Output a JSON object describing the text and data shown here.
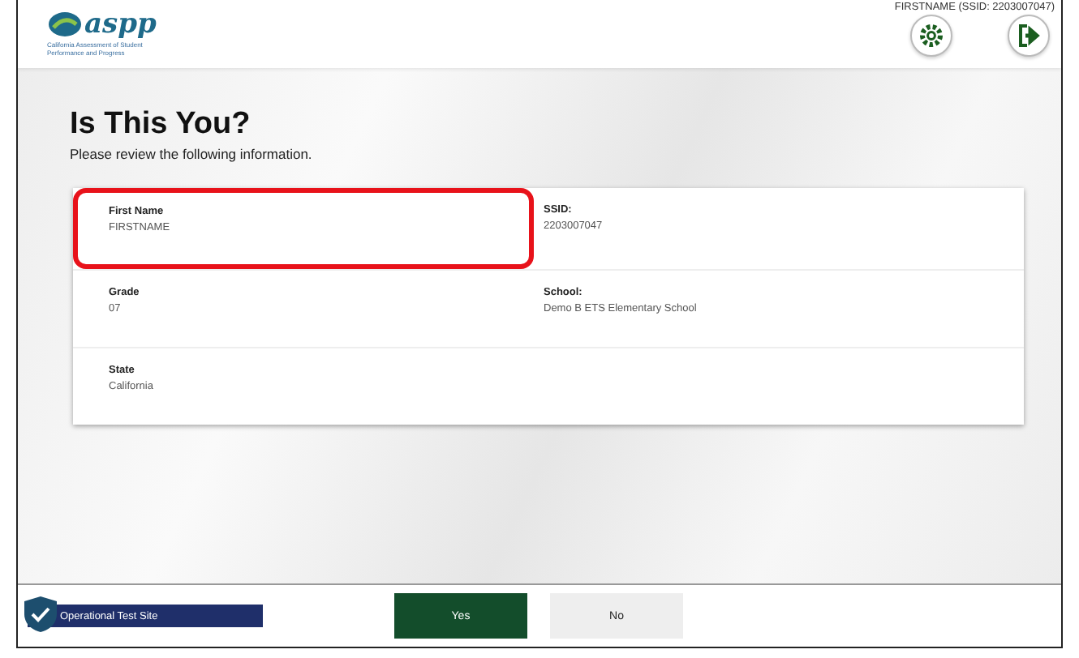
{
  "header": {
    "logo": "aspp",
    "logo_subtitle": "California Assessment of Student Performance and Progress",
    "user": "FIRSTNAME (SSID: 2203007047)"
  },
  "page": {
    "title": "Is This You?",
    "subtitle": "Please review the following information."
  },
  "fields": [
    {
      "label": "First Name",
      "value": "FIRSTNAME",
      "highlighted": true
    },
    {
      "label": "SSID:",
      "value": "2203007047",
      "highlighted": false
    },
    {
      "label": "Grade",
      "value": "07",
      "highlighted": false
    },
    {
      "label": "School:",
      "value": "Demo B ETS Elementary School",
      "highlighted": false
    },
    {
      "label": "State",
      "value": "California",
      "highlighted": false
    }
  ],
  "footer": {
    "site": "Operational Test Site",
    "buttons": [
      {
        "label": "Yes",
        "kind": "primary"
      },
      {
        "label": "No",
        "kind": "secondary"
      }
    ]
  }
}
